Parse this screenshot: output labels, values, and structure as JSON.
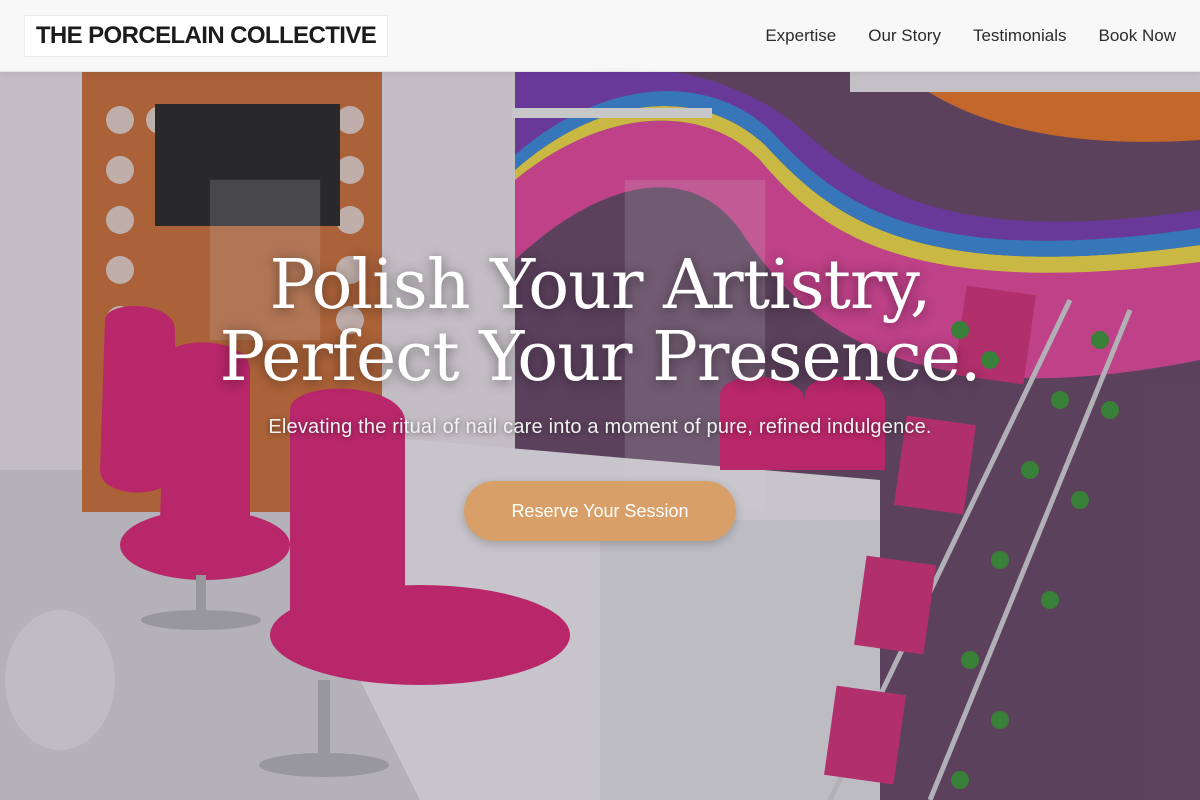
{
  "header": {
    "brand": "THE PORCELAIN COLLECTIVE",
    "nav": [
      {
        "label": "Expertise"
      },
      {
        "label": "Our Story"
      },
      {
        "label": "Testimonials"
      },
      {
        "label": "Book Now"
      }
    ]
  },
  "hero": {
    "headline_line1": "Polish Your Artistry,",
    "headline_line2": "Perfect Your Presence.",
    "tagline": "Elevating the ritual of nail care into a moment of pure, refined indulgence.",
    "cta_label": "Reserve Your Session",
    "background_image": "nail salon interior with pink chairs and rainbow mural"
  },
  "colors": {
    "cta": "#d8a068",
    "chair_pink": "#e0287a",
    "header_bg": "#fafafa"
  }
}
